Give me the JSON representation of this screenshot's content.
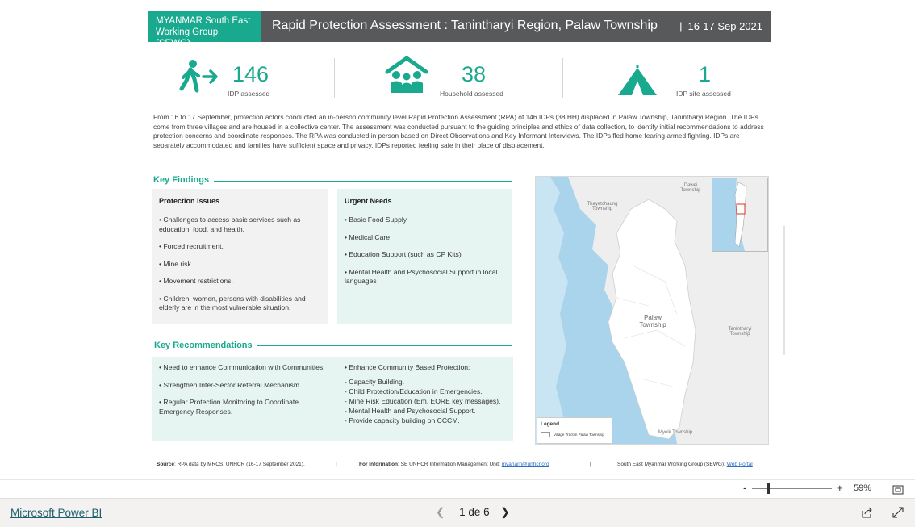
{
  "header": {
    "org_label": "MYANMAR South East Working Group (SEWG)",
    "title": "Rapid Protection Assessment : Tanintharyi Region, Palaw Township",
    "date": "16-17 Sep 2021"
  },
  "stats": [
    {
      "icon": "walking-person-arrow-icon",
      "value": "146",
      "label": "IDP assessed"
    },
    {
      "icon": "household-house-icon",
      "value": "38",
      "label": "Household assessed"
    },
    {
      "icon": "tent-icon",
      "value": "1",
      "label": "IDP site assessed"
    }
  ],
  "intro": "From 16 to 17 September, protection actors conducted an in-person community level Rapid Protection Assessment (RPA) of 146 IDPs (38 HH) displaced in Palaw Township, Tanintharyi Region. The IDPs come from three villages and are housed in a collective center. The assessment was conducted pursuant to the guiding principles and ethics of data collection, to identify initial recommendations to address protection concerns and coordinate responses. The RPA was conducted in person based on Direct Observations and Key Informant Interviews. The IDPs fled home fearing armed fighting. IDPs are separately accommodated and families have sufficient space and privacy. IDPs reported feeling safe in their place of displacement.",
  "key_findings": {
    "title": "Key Findings",
    "protection": {
      "title": "Protection Issues",
      "items": [
        "• Challenges to access basic services such as education, food, and health.",
        "• Forced recruitment.",
        "• Mine risk.",
        "• Movement restrictions.",
        "• Children, women, persons with disabilities and elderly are in the most vulnerable situation."
      ]
    },
    "urgent": {
      "title": "Urgent Needs",
      "items": [
        "• Basic Food Supply",
        "• Medical Care",
        "• Education Support (such as CP Kits)",
        "• Mental Health and Psychosocial Support in local languages"
      ]
    }
  },
  "key_recommendations": {
    "title": "Key Recommendations",
    "left": [
      "• Need to enhance Communication with Communities.",
      "• Strengthen Inter-Sector Referral Mechanism.",
      "• Regular Protection Monitoring to Coordinate Emergency Responses."
    ],
    "right_title": "• Enhance Community Based Protection:",
    "right": [
      "- Capacity Building.",
      "- Child Protection/Education in Emergencies.",
      "- Mine Risk Education (Em. EORE key messages).",
      "- Mental Health and Psychosocial Support.",
      "- Provide capacity building on CCCM."
    ]
  },
  "map": {
    "labels": {
      "thayetchaung": "Thayetchaung Township",
      "dawei": "Dawei Township",
      "palaw": "Palaw Township",
      "tanintharyi": "Tanintharyi Township",
      "myeik": "Myeik Township"
    },
    "legend_title": "Legend",
    "legend_item": "Village Tract in Palaw Township"
  },
  "footer": {
    "source_label": "Source",
    "source_text": ": RPA data by MRCS, UNHCR (16-17 September 2021).",
    "info_label": "For Information",
    "info_text": ": SE UNHCR Information Management Unit: ",
    "info_email": "myaharn@unhcr.org",
    "sewg_text": "South East Myanmar Working Group (SEWG): ",
    "sewg_link": "Web Portal"
  },
  "zoom": {
    "minus": "-",
    "plus": "+",
    "value": "59%",
    "level": 0.18
  },
  "powerbi": {
    "link": "Microsoft Power BI",
    "pager": "1 de 6"
  },
  "colors": {
    "accent": "#19a98f",
    "header_grey": "#58595b",
    "mint": "#e6f5f1",
    "grey_box": "#f2f2f2"
  }
}
